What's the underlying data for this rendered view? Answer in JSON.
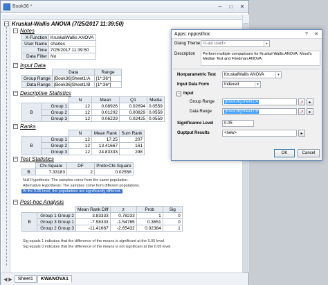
{
  "workbook": {
    "title": "Book36 *",
    "report_title": "Kruskal-Wallis ANOVA (7/25/2017 11:39:50)",
    "tabs": [
      "Sheet1",
      "KWANOVA1"
    ],
    "active_tab": "KWANOVA1"
  },
  "notes": {
    "heading": "Notes",
    "rows": [
      {
        "label": "X-Function",
        "value": "KruskalWallis ANOVA"
      },
      {
        "label": "User Name",
        "value": "charles"
      },
      {
        "label": "Time",
        "value": "7/25/2017 11:39:50"
      },
      {
        "label": "Data Filter",
        "value": "No"
      }
    ]
  },
  "input_data": {
    "heading": "Input Data",
    "col_data": "Data",
    "col_range": "Range",
    "rows": [
      {
        "label": "Group Range",
        "data": "[Book36]Sheet1!A",
        "range": "[1*:36*]"
      },
      {
        "label": "Data Range",
        "data": "[Book36]Sheet1!B",
        "range": "[1*:36*]"
      }
    ]
  },
  "descriptive": {
    "heading": "Descriptive Statistics",
    "col_n": "N",
    "col_mean": "Mean",
    "col_q1": "Q1",
    "col_median": "Media",
    "group_label": "B",
    "rows": [
      {
        "group": "Group 1",
        "n": "12",
        "mean": "0.08926",
        "q1": "0.02694",
        "median": "0.0559"
      },
      {
        "group": "Group 2",
        "n": "12",
        "mean": "0.01202",
        "q1": "0.00829",
        "median": "0.0559"
      },
      {
        "group": "Group 3",
        "n": "12",
        "mean": "0.06229",
        "q1": "0.02425",
        "median": "0.0559"
      }
    ]
  },
  "ranks": {
    "heading": "Ranks",
    "col_n": "N",
    "col_mean_rank": "Mean Rank",
    "col_sum_rank": "Sum Rank",
    "group_label": "B",
    "rows": [
      {
        "group": "Group 1",
        "n": "12",
        "mean_rank": "17.25",
        "sum_rank": "207"
      },
      {
        "group": "Group 2",
        "n": "12",
        "mean_rank": "13.41667",
        "sum_rank": "161"
      },
      {
        "group": "Group 3",
        "n": "12",
        "mean_rank": "24.83333",
        "sum_rank": "298"
      }
    ]
  },
  "test_statistics": {
    "heading": "Test Statistics",
    "col_chi": "Chi-Square",
    "col_df": "DF",
    "col_prob": "Prob>Chi-Square",
    "chi": "7.33183",
    "df": "2",
    "prob": "0.02558",
    "null_hypothesis": "Null Hypothesis: The samples come from the same population.",
    "alt_hypothesis": "Alternative Hypothesis: The samples come from different populations.",
    "conclusion": "At the 0.05 level, the populations are significantly different."
  },
  "posthoc": {
    "heading": "Post-hoc Analysis",
    "col_diff": "Mean Rank Diff",
    "col_z": "z",
    "col_prob": "Prob",
    "col_sig": "Sig",
    "group_label": "B",
    "rows": [
      {
        "pair": "Group 1 Group 2",
        "diff": "3.83333",
        "z": "0.78233",
        "prob": "1",
        "sig": "0"
      },
      {
        "pair": "Group 3 Group 1",
        "diff": "-7.58333",
        "z": "-1.54765",
        "prob": "0.3651",
        "sig": "0"
      },
      {
        "pair": "Group 2 Group 3",
        "diff": "-11.41667",
        "z": "-2.65432",
        "prob": "0.02384",
        "sig": "1"
      }
    ],
    "note1": "Sig equals 1 indicates that the difference of the means is significant at the 0.05 level.",
    "note2": "Sig equals 0 indicates that the difference of the means is not significant at the 0.05 level."
  },
  "dialog": {
    "title": "Apps: npposthoc",
    "theme_label": "Dialog Theme",
    "theme_value": "<Last used>",
    "description_label": "Description",
    "description_text": "Perform multiple comparisons for Kruskal-Wallis ANOVA, Mood's Median Test and Friedman ANOVA.",
    "nonparam_label": "Nonparametric Test",
    "nonparam_value": "KruskalWallis ANOVA",
    "input_form_label": "Input Data Form",
    "input_form_value": "Indexed",
    "input_section": "Input",
    "group_range_label": "Group Range",
    "group_range_value": "[Book36]Sheet1!A",
    "data_range_label": "Data Range",
    "data_range_value": "[Book36]Sheet1!B",
    "sig_label": "Significance Level",
    "sig_value": "0.05",
    "output_label": "Ouptput Results",
    "output_value": "<new>",
    "ok": "OK",
    "cancel": "Cancel"
  }
}
